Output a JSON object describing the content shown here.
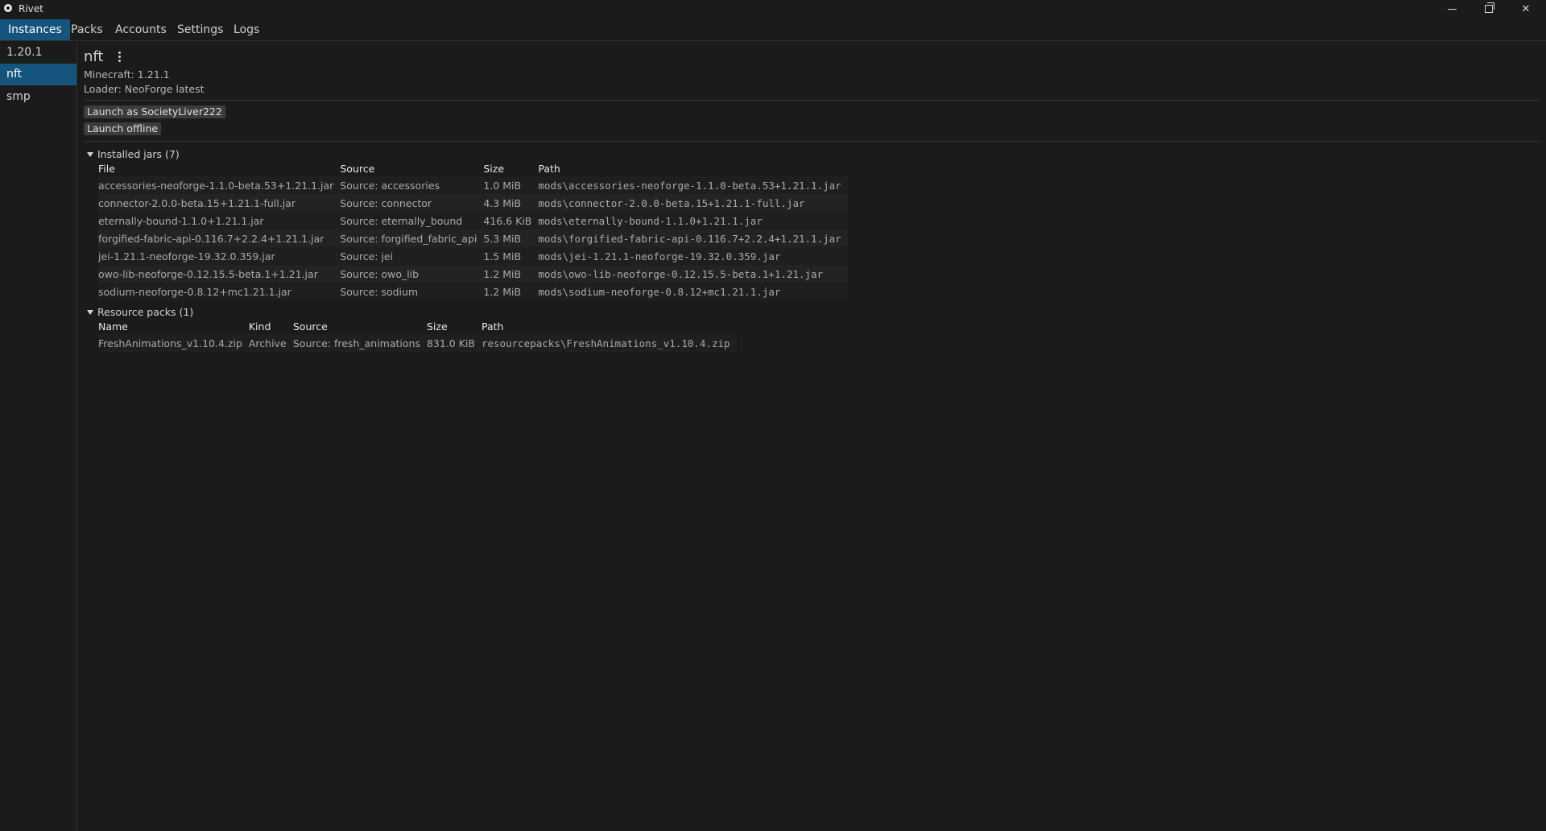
{
  "window": {
    "title": "Rivet",
    "minimize_icon": "minimize-icon",
    "maximize_icon": "restore-icon",
    "close_icon": "close-icon",
    "close_glyph": "✕"
  },
  "tabs": [
    {
      "label": "Instances",
      "active": true
    },
    {
      "label": "Packs"
    },
    {
      "label": "Accounts"
    },
    {
      "label": "Settings"
    },
    {
      "label": "Logs"
    }
  ],
  "sidebar": {
    "items": [
      {
        "label": "1.20.1"
      },
      {
        "label": "nft",
        "active": true
      },
      {
        "label": "smp"
      }
    ]
  },
  "instance": {
    "name": "nft",
    "minecraft": "Minecraft: 1.21.1",
    "loader": "Loader: NeoForge latest",
    "launch_as_label": "Launch as SocietyLiver222",
    "launch_offline_label": "Launch offline"
  },
  "jars": {
    "header": "Installed jars (7)",
    "columns": [
      "File",
      "Source",
      "Size",
      "Path"
    ],
    "rows": [
      {
        "file": "accessories-neoforge-1.1.0-beta.53+1.21.1.jar",
        "source": "Source: accessories",
        "size": "1.0 MiB",
        "path": "mods\\accessories-neoforge-1.1.0-beta.53+1.21.1.jar"
      },
      {
        "file": "connector-2.0.0-beta.15+1.21.1-full.jar",
        "source": "Source: connector",
        "size": "4.3 MiB",
        "path": "mods\\connector-2.0.0-beta.15+1.21.1-full.jar"
      },
      {
        "file": "eternally-bound-1.1.0+1.21.1.jar",
        "source": "Source: eternally_bound",
        "size": "416.6 KiB",
        "path": "mods\\eternally-bound-1.1.0+1.21.1.jar"
      },
      {
        "file": "forgified-fabric-api-0.116.7+2.2.4+1.21.1.jar",
        "source": "Source: forgified_fabric_api",
        "size": "5.3 MiB",
        "path": "mods\\forgified-fabric-api-0.116.7+2.2.4+1.21.1.jar"
      },
      {
        "file": "jei-1.21.1-neoforge-19.32.0.359.jar",
        "source": "Source: jei",
        "size": "1.5 MiB",
        "path": "mods\\jei-1.21.1-neoforge-19.32.0.359.jar"
      },
      {
        "file": "owo-lib-neoforge-0.12.15.5-beta.1+1.21.jar",
        "source": "Source: owo_lib",
        "size": "1.2 MiB",
        "path": "mods\\owo-lib-neoforge-0.12.15.5-beta.1+1.21.jar"
      },
      {
        "file": "sodium-neoforge-0.8.12+mc1.21.1.jar",
        "source": "Source: sodium",
        "size": "1.2 MiB",
        "path": "mods\\sodium-neoforge-0.8.12+mc1.21.1.jar"
      }
    ]
  },
  "resource_packs": {
    "header": "Resource packs (1)",
    "columns": [
      "Name",
      "Kind",
      "Source",
      "Size",
      "Path"
    ],
    "rows": [
      {
        "name": "FreshAnimations_v1.10.4.zip",
        "kind": "Archive",
        "source": "Source: fresh_animations",
        "size": "831.0 KiB",
        "path": "resourcepacks\\FreshAnimations_v1.10.4.zip"
      }
    ]
  }
}
